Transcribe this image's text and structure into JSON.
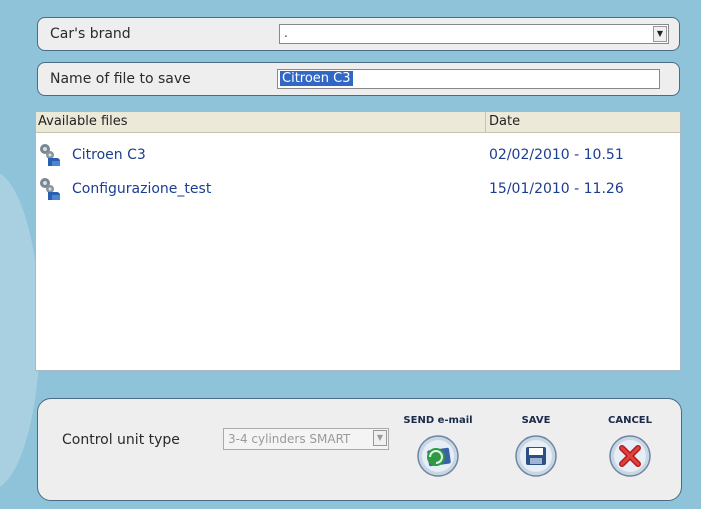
{
  "brand": {
    "label": "Car's brand",
    "value": "."
  },
  "filename": {
    "label": "Name of file to save",
    "value": "Citroen C3"
  },
  "files": {
    "headers": {
      "name": "Available files",
      "date": "Date"
    },
    "rows": [
      {
        "name": "Citroen C3",
        "date": "02/02/2010 - 10.51",
        "icon": "puzzle-gear-icon"
      },
      {
        "name": "Configurazione_test",
        "date": "15/01/2010 - 11.26",
        "icon": "puzzle-gear-icon"
      }
    ]
  },
  "control_unit": {
    "label": "Control unit type",
    "value": "3-4 cylinders SMART"
  },
  "actions": {
    "email": {
      "label": "SEND e-mail",
      "icon": "email-globe-icon"
    },
    "save": {
      "label": "SAVE",
      "icon": "floppy-disk-icon"
    },
    "cancel": {
      "label": "CANCEL",
      "icon": "red-x-icon"
    }
  },
  "colors": {
    "background": "#8ec3d9",
    "panel": "#eeeeee",
    "panel_border": "#4a6b85",
    "selection": "#3168c6",
    "file_text": "#1c3d8f",
    "header_bg": "#ece9d8"
  }
}
